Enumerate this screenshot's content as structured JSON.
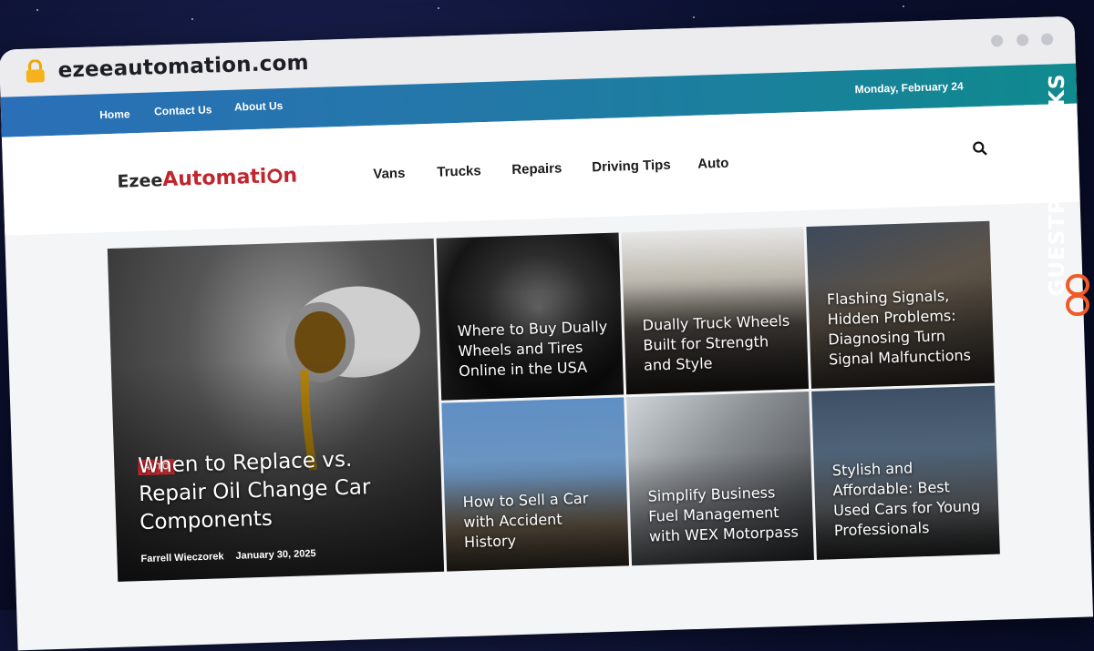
{
  "browser": {
    "url": "ezeeautomation.com"
  },
  "topbar": {
    "links": [
      "Home",
      "Contact Us",
      "About Us"
    ],
    "date": "Monday, February 24"
  },
  "header": {
    "logo_part1": "Ezee",
    "logo_part2": "Automati",
    "logo_part3": "n",
    "nav": [
      "Vans",
      "Trucks",
      "Repairs",
      "Driving Tips",
      "Auto"
    ]
  },
  "featured": {
    "main": {
      "category": "AUTO",
      "title": "When to Replace vs. Repair Oil Change Car Components",
      "author": "Farrell Wieczorek",
      "date": "January 30, 2025"
    },
    "tiles": [
      {
        "title": "Where to Buy Dually Wheels and Tires Online in the USA"
      },
      {
        "title": "Dually Truck Wheels Built for Strength and Style"
      },
      {
        "title": "Flashing Signals, Hidden Problems: Diagnosing Turn Signal Malfunctions"
      },
      {
        "title": "How to Sell a Car with Accident History"
      },
      {
        "title": "Simplify Business Fuel Management with WEX Motorpass"
      },
      {
        "title": "Stylish and Affordable: Best Used Cars for Young Professionals"
      }
    ]
  },
  "watermark": {
    "text": "GUESTPOSTLINKS"
  },
  "colors": {
    "brand_red": "#c0262d",
    "nav_blue": "#2a6fb8",
    "nav_teal": "#0f8a8e",
    "watermark_orange": "#f05a28"
  }
}
